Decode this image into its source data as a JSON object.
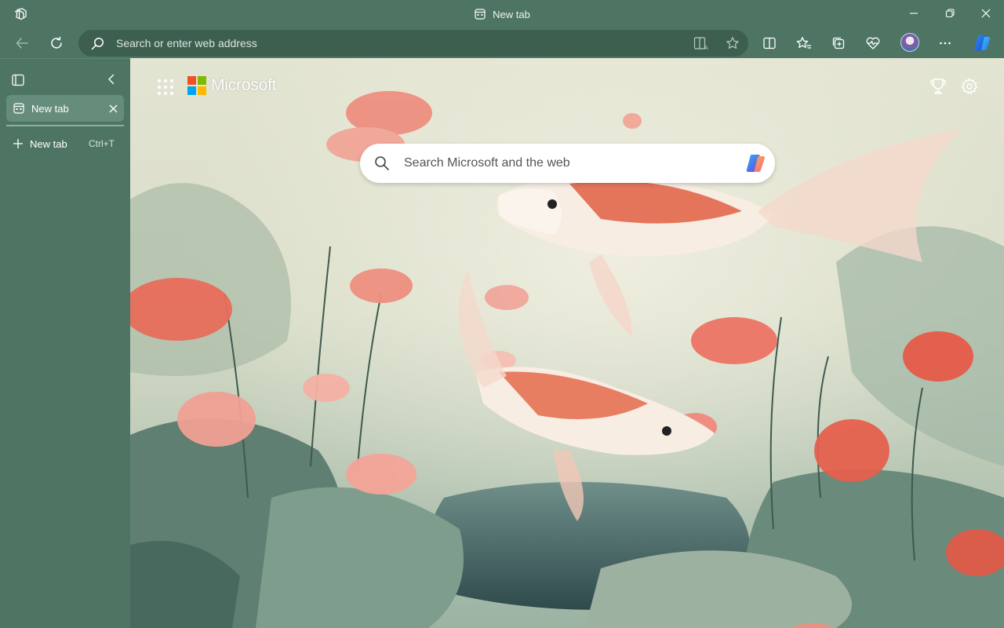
{
  "window": {
    "title": "New tab"
  },
  "toolbar": {
    "address_placeholder": "Search or enter web address"
  },
  "sidebar": {
    "tabs": [
      {
        "label": "New tab",
        "active": true
      }
    ],
    "new_tab_label": "New tab",
    "new_tab_shortcut": "Ctrl+T"
  },
  "page": {
    "brand": "Microsoft",
    "search_placeholder": "Search Microsoft and the web"
  },
  "icons": {
    "workspaces": "workspaces-icon",
    "back": "back-arrow-icon",
    "refresh": "refresh-icon",
    "immersive_reader": "immersive-reader-icon",
    "favorite": "star-icon",
    "split_screen": "split-screen-icon",
    "favorites": "favorites-icon",
    "collections": "collections-icon",
    "browser_essentials": "heart-pulse-icon",
    "more": "more-icon",
    "copilot": "copilot-icon",
    "rewards": "trophy-icon",
    "settings": "gear-icon"
  },
  "colors": {
    "frame": "#4e7563",
    "address_bar": "#3d5f50",
    "active_tab": "#668d7b",
    "ms_red": "#f25022",
    "ms_green": "#7fba00",
    "ms_blue": "#00a4ef",
    "ms_yellow": "#ffb900"
  }
}
